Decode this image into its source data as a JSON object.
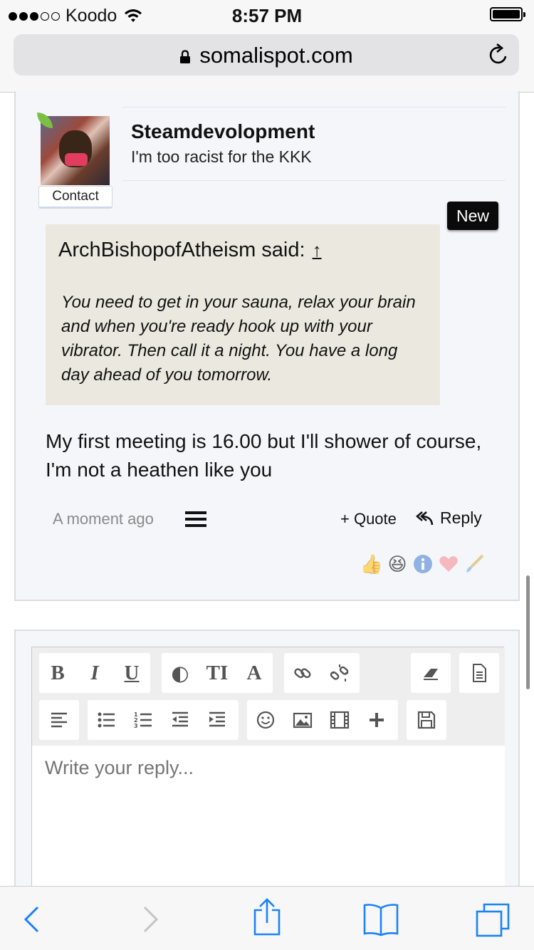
{
  "status_bar": {
    "carrier": "Koodo",
    "time": "8:57 PM"
  },
  "browser": {
    "url": "somalispot.com"
  },
  "post": {
    "username": "Steamdevolopment",
    "user_title": "I'm too racist for the KKK",
    "contact_label": "Contact",
    "new_badge": "New",
    "quote": {
      "author_line": "ArchBishopofAtheism said:",
      "arrow": "↑",
      "text": "You need to get in your sauna, relax your brain and when you're ready hook up with your vibrator. Then call it a night. You have a long day ahead of you tomorrow."
    },
    "message": "My first meeting is 16.00 but I'll shower of course, I'm not a heathen like you",
    "timestamp": "A moment ago",
    "quote_button": "+ Quote",
    "reply_button": "Reply",
    "reactions": [
      "like-icon",
      "laugh-icon",
      "info-icon",
      "love-icon",
      "brush-icon"
    ]
  },
  "editor": {
    "toolbar_row1": [
      "B",
      "I",
      "U",
      "◐",
      "TI",
      "A"
    ],
    "placeholder": "Write your reply..."
  },
  "bottom_toolbar": {
    "icons": [
      "back-icon",
      "forward-icon",
      "share-icon",
      "bookmarks-icon",
      "tabs-icon"
    ]
  },
  "colors": {
    "ios_blue": "#1a82fb",
    "quote_bg": "#ebe9df",
    "card_bg": "#f5f6fa"
  }
}
